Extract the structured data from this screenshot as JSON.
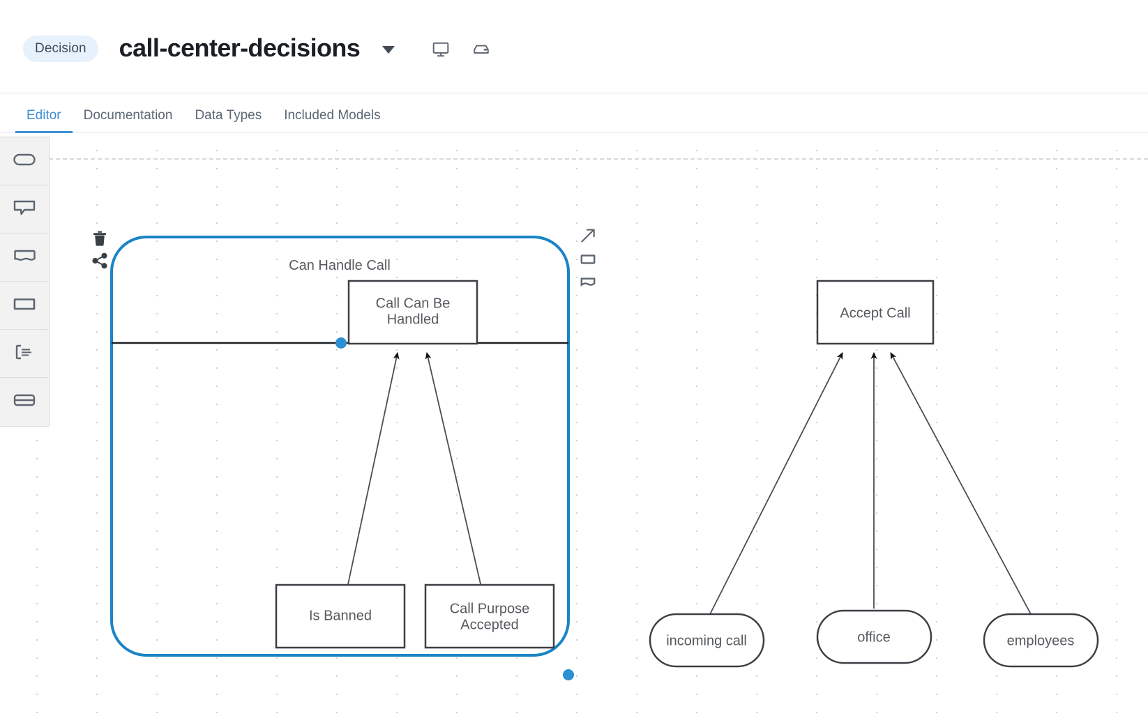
{
  "header": {
    "badge": "Decision",
    "title": "call-center-decisions",
    "caret_icon": "chevron-down-icon",
    "icons": [
      {
        "name": "monitor-icon",
        "label": "Deploy / Preview"
      },
      {
        "name": "server-icon",
        "label": "Server"
      }
    ]
  },
  "tabs": [
    {
      "label": "Editor",
      "active": true
    },
    {
      "label": "Documentation",
      "active": false
    },
    {
      "label": "Data Types",
      "active": false
    },
    {
      "label": "Included Models",
      "active": false
    }
  ],
  "palette": {
    "items": [
      {
        "name": "palette-input-data",
        "icon": "stadium-icon",
        "label": "Input Data"
      },
      {
        "name": "palette-text-annotation",
        "icon": "annotation-callout-icon",
        "label": "Text Annotation"
      },
      {
        "name": "palette-knowledge-source",
        "icon": "knowledge-source-icon",
        "label": "Knowledge Source"
      },
      {
        "name": "palette-decision",
        "icon": "rectangle-icon",
        "label": "Decision"
      },
      {
        "name": "palette-text-bracket",
        "icon": "text-bracket-icon",
        "label": "Text"
      },
      {
        "name": "palette-decision-service",
        "icon": "decision-service-icon",
        "label": "Decision Service"
      }
    ]
  },
  "canvas": {
    "selection": {
      "selected_node": "Can Handle Call",
      "context_icons": [
        {
          "name": "delete-icon",
          "label": "Delete"
        },
        {
          "name": "share-connect-icon",
          "label": "Connect"
        },
        {
          "name": "expand-arrow-icon",
          "label": "Expand"
        },
        {
          "name": "decision-shape-icon",
          "label": "Decision"
        },
        {
          "name": "knowledge-source-shape-icon",
          "label": "Knowledge Source"
        }
      ]
    },
    "groups": [
      {
        "id": "can-handle-call",
        "label": "Can Handle Call",
        "selected": true
      }
    ],
    "decisions": [
      {
        "id": "call-can-be-handled",
        "label_line1": "Call Can Be",
        "label_line2": "Handled"
      },
      {
        "id": "is-banned",
        "label_line1": "Is Banned",
        "label_line2": ""
      },
      {
        "id": "call-purpose-accepted",
        "label_line1": "Call Purpose",
        "label_line2": "Accepted"
      },
      {
        "id": "accept-call",
        "label_line1": "Accept Call",
        "label_line2": ""
      }
    ],
    "input_data": [
      {
        "id": "incoming-call",
        "label": "incoming call"
      },
      {
        "id": "office",
        "label": "office"
      },
      {
        "id": "employees",
        "label": "employees"
      }
    ]
  },
  "colors": {
    "accent": "#3b8fd4",
    "selection": "#1a84c6",
    "badge_bg": "#e7f1fb",
    "node_stroke": "#3b3f44",
    "text": "#55595e"
  }
}
